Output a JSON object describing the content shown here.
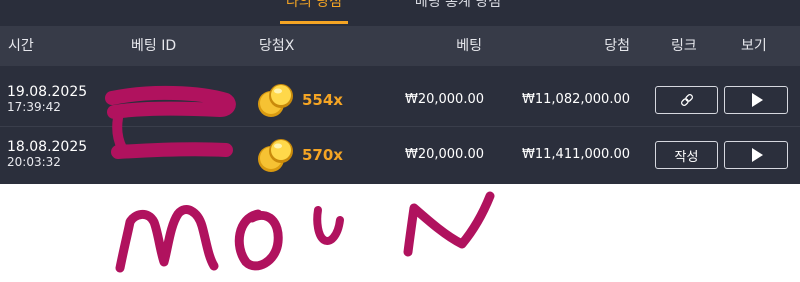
{
  "tabs": {
    "active_label": "나의 당첨",
    "inactive_label": "베팅 통계 당첨"
  },
  "header": {
    "time": "시간",
    "bet_id": "베팅 ID",
    "multiplier": "당첨X",
    "bet": "베팅",
    "win": "당첨",
    "link": "링크",
    "view": "보기"
  },
  "rows": [
    {
      "date": "19.08.2025",
      "time": "17:39:42",
      "multiplier": "554x",
      "bet": "₩20,000.00",
      "win": "₩11,082,000.00",
      "link_button": "link-icon"
    },
    {
      "date": "18.08.2025",
      "time": "20:03:32",
      "multiplier": "570x",
      "bet": "₩20,000.00",
      "win": "₩11,411,000.00",
      "link_button_label": "작성"
    }
  ],
  "handwriting": "moon",
  "colors": {
    "accent": "#f5a524",
    "header_bg": "#373b48",
    "row_bg": "#2b2f3c",
    "scribble": "#b0125e"
  }
}
